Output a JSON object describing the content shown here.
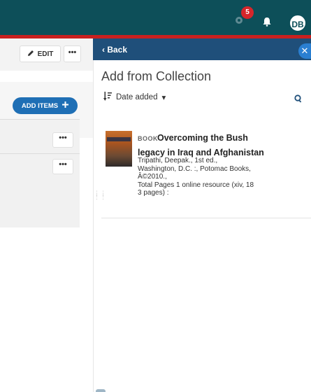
{
  "header": {
    "notifications_count": "5",
    "avatar_initials": "DB",
    "colors": {
      "bar": "#0d4f59",
      "accent_line": "#c9201f",
      "badge": "#d6262b"
    }
  },
  "left": {
    "edit_label": "EDIT",
    "more_label": "•••",
    "add_items_label": "ADD ITEMS",
    "row_more_label": "•••",
    "button_color": "#1f6fb5"
  },
  "panel": {
    "back_label": "Back",
    "title": "Add from Collection",
    "sort_label": "Date added",
    "results": [
      {
        "type": "BOOK",
        "title": "Overcoming the Bush legacy in Iraq and Afghanistan",
        "meta_lines": [
          "Tripathi, Deepak., 1st ed.,",
          "Washington, D.C. :, Potomac Books,",
          "Â©2010.,",
          "Total Pages 1 online resource (xiv, 18",
          "3 pages) :"
        ]
      }
    ]
  }
}
